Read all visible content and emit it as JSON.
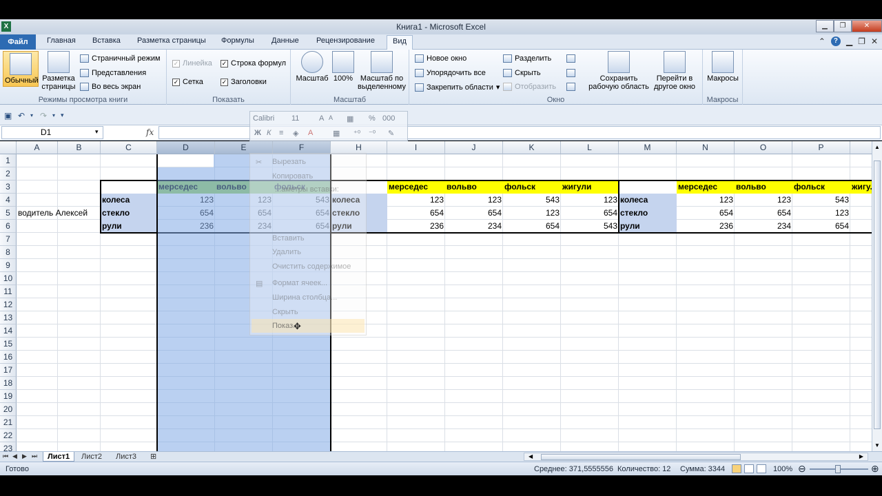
{
  "window": {
    "title": "Книга1  -  Microsoft Excel"
  },
  "tabs": [
    {
      "label": "Файл"
    },
    {
      "label": "Главная"
    },
    {
      "label": "Вставка"
    },
    {
      "label": "Разметка страницы"
    },
    {
      "label": "Формулы"
    },
    {
      "label": "Данные"
    },
    {
      "label": "Рецензирование"
    },
    {
      "label": "Вид"
    }
  ],
  "ribbon": {
    "views": {
      "normal": "Обычный",
      "pagelayout1": "Разметка",
      "pagelayout2": "страницы",
      "pagebreak": "Страничный режим",
      "custom": "Представления",
      "fullscreen": "Во весь экран",
      "label": "Режимы просмотра книги"
    },
    "show": {
      "ruler": "Линейка",
      "formulabar": "Строка формул",
      "gridlines": "Сетка",
      "headings": "Заголовки",
      "label": "Показать"
    },
    "zoom": {
      "zoom": "Масштаб",
      "hundred": "100%",
      "selection1": "Масштаб по",
      "selection2": "выделенному",
      "label": "Масштаб"
    },
    "window": {
      "newwin": "Новое окно",
      "arrange": "Упорядочить все",
      "freeze": "Закрепить области",
      "split": "Разделить",
      "hide": "Скрыть",
      "unhide": "Отобразить",
      "save1": "Сохранить",
      "save2": "рабочую область",
      "switch1": "Перейти в",
      "switch2": "другое окно",
      "label": "Окно"
    },
    "macros": {
      "macros": "Макросы",
      "label": "Макросы"
    }
  },
  "formulabar": {
    "namebox": "D1",
    "fx": "fx"
  },
  "minitoolbar": {
    "font": "Calibri",
    "size": "11",
    "percent": "%",
    "thousands": "000",
    "bold": "Ж",
    "italic": "К"
  },
  "columns": [
    "A",
    "B",
    "C",
    "D",
    "E",
    "F",
    "G",
    "H",
    "I",
    "J",
    "K",
    "L",
    "M",
    "N",
    "O",
    "P",
    ""
  ],
  "rows": [
    "1",
    "2",
    "3",
    "4",
    "5",
    "6",
    "7",
    "8",
    "9",
    "10",
    "11",
    "12",
    "13",
    "14",
    "15",
    "16",
    "17",
    "18",
    "19",
    "20",
    "21",
    "22",
    "23"
  ],
  "cells": {
    "a5": "водитель Алексей",
    "table1": {
      "headers": [
        "мерседес",
        "вольво",
        "фольск"
      ],
      "rows": [
        {
          "label": "колеса",
          "v": [
            "123",
            "123",
            "543"
          ]
        },
        {
          "label": "стекло",
          "v": [
            "654",
            "654",
            "654"
          ]
        },
        {
          "label": "рули",
          "v": [
            "236",
            "234",
            "654"
          ]
        }
      ]
    },
    "table2": {
      "headers": [
        "мерседес",
        "вольво",
        "фольск",
        "жигули"
      ],
      "rows": [
        {
          "label": "колеса",
          "v": [
            "123",
            "123",
            "543",
            "123"
          ]
        },
        {
          "label": "стекло",
          "v": [
            "654",
            "654",
            "123",
            "654"
          ]
        },
        {
          "label": "рули",
          "v": [
            "236",
            "234",
            "654",
            "543"
          ]
        }
      ]
    },
    "table3": {
      "headers": [
        "мерседес",
        "вольво",
        "фольск",
        "жигу..."
      ],
      "rows": [
        {
          "label": "колеса",
          "v": [
            "123",
            "123",
            "543"
          ]
        },
        {
          "label": "стекло",
          "v": [
            "654",
            "654",
            "123"
          ]
        },
        {
          "label": "рули",
          "v": [
            "236",
            "234",
            "654"
          ]
        }
      ]
    }
  },
  "contextmenu": {
    "cut": "Вырезать",
    "copy": "Копировать",
    "paste_options": "...аметры вставки:",
    "insert": "Вставить",
    "delete": "Удалить",
    "clear": "Очистить содержимое",
    "format": "Формат ячеек...",
    "width": "Ширина столбца...",
    "hide": "Скрыть",
    "show": "Показ..."
  },
  "sheets": [
    {
      "label": "Лист1"
    },
    {
      "label": "Лист2"
    },
    {
      "label": "Лист3"
    }
  ],
  "status": {
    "ready": "Готово",
    "average": "Среднее: 371,5555556",
    "count": "Количество: 12",
    "sum": "Сумма: 3344",
    "zoom": "100%"
  },
  "colors": {
    "green_header": "#9bd15a",
    "yellow_header": "#ffff00",
    "label_blue": "#c5d4ee"
  }
}
